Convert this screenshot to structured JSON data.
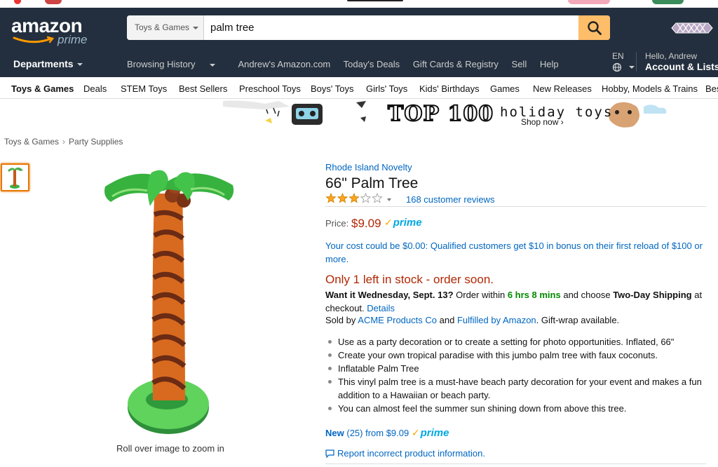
{
  "header": {
    "logo_text": "amazon",
    "logo_sub": "prime",
    "search_category": "Toys & Games",
    "search_value": "palm tree"
  },
  "nav": {
    "departments_label": "Departments",
    "links": [
      "Browsing History",
      "Andrew's Amazon.com",
      "Today's Deals",
      "Gift Cards & Registry",
      "Sell",
      "Help"
    ],
    "language": "EN",
    "greeting": "Hello, Andrew",
    "account_label": "Account & Lists"
  },
  "subnav": {
    "items": [
      "Toys & Games",
      "Deals",
      "STEM Toys",
      "Best Sellers",
      "Preschool Toys",
      "Boys' Toys",
      "Girls' Toys",
      "Kids' Birthdays",
      "Games",
      "New Releases",
      "Hobby, Models & Trains",
      "Bes"
    ]
  },
  "banner": {
    "headline": "TOP 100",
    "title": "holiday toys",
    "cta": "Shop now ›"
  },
  "breadcrumb": [
    "Toys & Games",
    "Party Supplies"
  ],
  "product": {
    "brand": "Rhode Island Novelty",
    "title": "66\" Palm Tree",
    "rating": 3,
    "rating_max": 5,
    "reviews": "168 customer reviews",
    "price_label": "Price:",
    "price": "$9.09",
    "prime_label": "prime",
    "promo": "Your cost could be $0.00: Qualified customers get $10 in bonus on their first reload of $100 or more.",
    "stock": "Only 1 left in stock - order soon.",
    "ship_when": "Want it Wednesday, Sept. 13?",
    "ship_order": "Order within",
    "ship_time": "6 hrs 8 mins",
    "ship_choose": "and choose",
    "ship_method": "Two-Day Shipping",
    "ship_at": "at checkout.",
    "details_link": "Details",
    "sold_by_prefix": "Sold by",
    "seller": "ACME Products Co",
    "and": "and",
    "fulfilled": "Fulfilled by Amazon",
    "giftwrap": ". Gift-wrap available.",
    "bullets": [
      "Use as a party decoration or to create a setting for photo opportunities. Inflated, 66\"",
      "Create your own tropical paradise with this jumbo palm tree with faux coconuts.",
      "Inflatable Palm Tree",
      "This vinyl palm tree is a must-have beach party decoration for your event and makes a fun addition to a Hawaiian or beach party.",
      "You can almost feel the summer sun shining down from above this tree."
    ],
    "new_label": "New",
    "new_offers": "(25) from $9.09",
    "report": "Report incorrect product information.",
    "zoom_note": "Roll over image to zoom in"
  },
  "colors": {
    "header_bg": "#232f3e",
    "search_button": "#febd69",
    "price": "#b12704",
    "link": "#0066c0",
    "prime_check": "#f7a700",
    "prime_word": "#00a8e1",
    "star": "#ffa41c"
  }
}
